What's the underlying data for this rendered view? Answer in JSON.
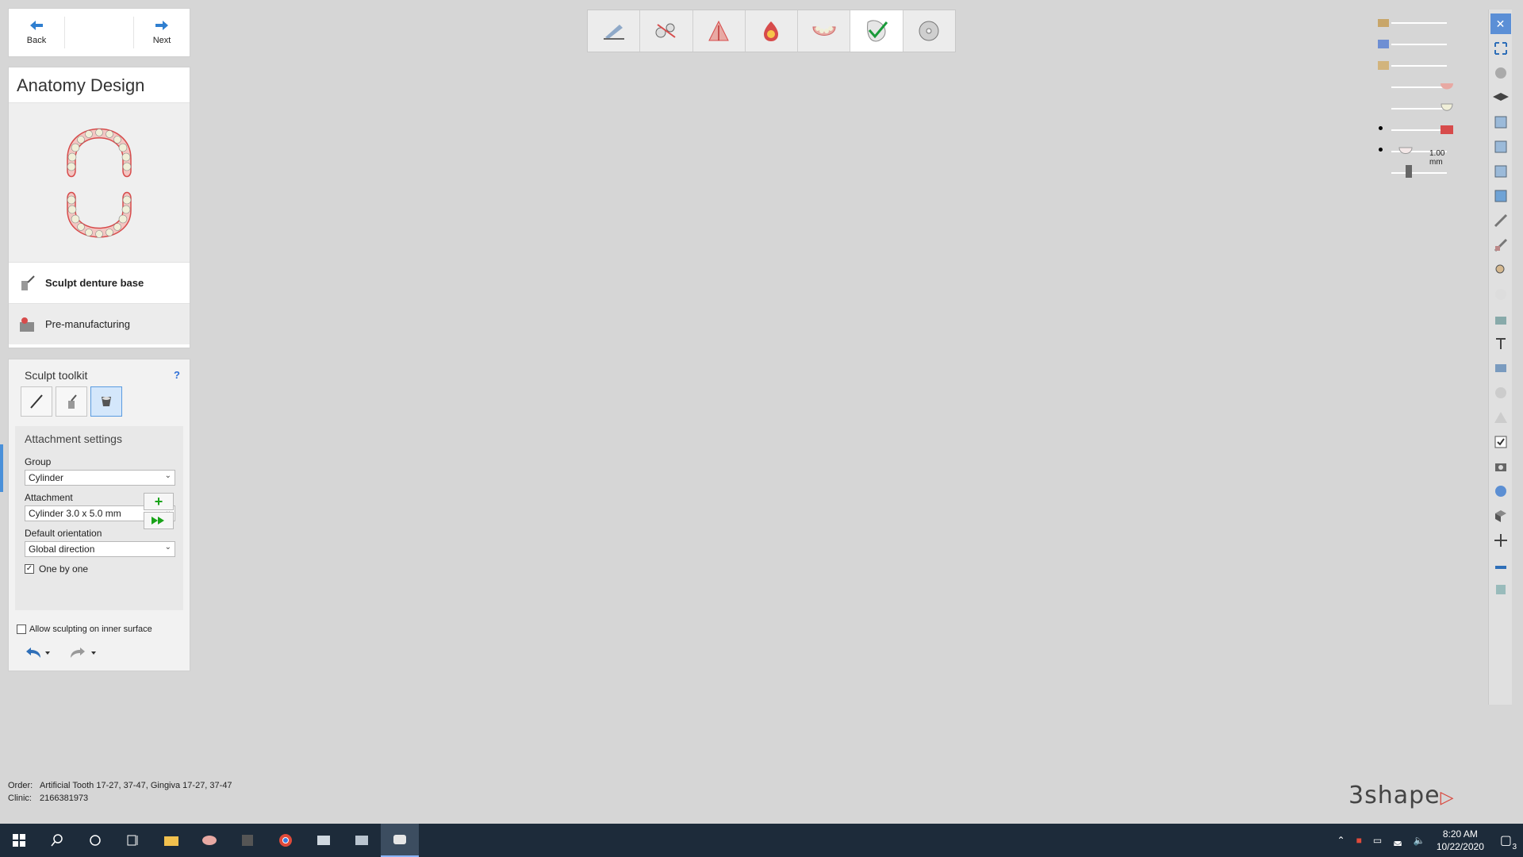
{
  "nav": {
    "back_label": "Back",
    "next_label": "Next"
  },
  "anatomy": {
    "title": "Anatomy Design",
    "steps": [
      {
        "label": "Sculpt denture base",
        "active": true
      },
      {
        "label": "Pre-manufacturing",
        "active": false
      }
    ]
  },
  "toolkit": {
    "title": "Sculpt toolkit",
    "help": "?",
    "attachment_settings": {
      "title": "Attachment settings",
      "group_label": "Group",
      "group_value": "Cylinder",
      "attachment_label": "Attachment",
      "attachment_value": "Cylinder 3.0 x 5.0 mm",
      "orientation_label": "Default orientation",
      "orientation_value": "Global direction",
      "one_by_one_label": "One by one",
      "one_by_one_checked": true
    },
    "allow_inner_label": "Allow sculpting on inner surface",
    "allow_inner_checked": false
  },
  "info": {
    "order_key": "Order:",
    "order_value": "Artificial Tooth 17-27, 37-47, Gingiva 17-27, 37-47",
    "clinic_key": "Clinic:",
    "clinic_value": "2166381973"
  },
  "wizard_steps": [
    "prepare-icon",
    "margin-icon",
    "tooth-icon",
    "color-icon",
    "gingiva-icon",
    "check-icon",
    "disc-icon"
  ],
  "wizard_active_index": 5,
  "slider_readout": "1.00 mm",
  "logo_text": "3shape",
  "taskbar": {
    "time": "8:20 AM",
    "date": "10/22/2020",
    "notifications": "3"
  },
  "colors": {
    "accent": "#4a90d9",
    "gingiva": "#e8a9a3",
    "tooth": "#f0efd8",
    "green": "#19a319"
  }
}
